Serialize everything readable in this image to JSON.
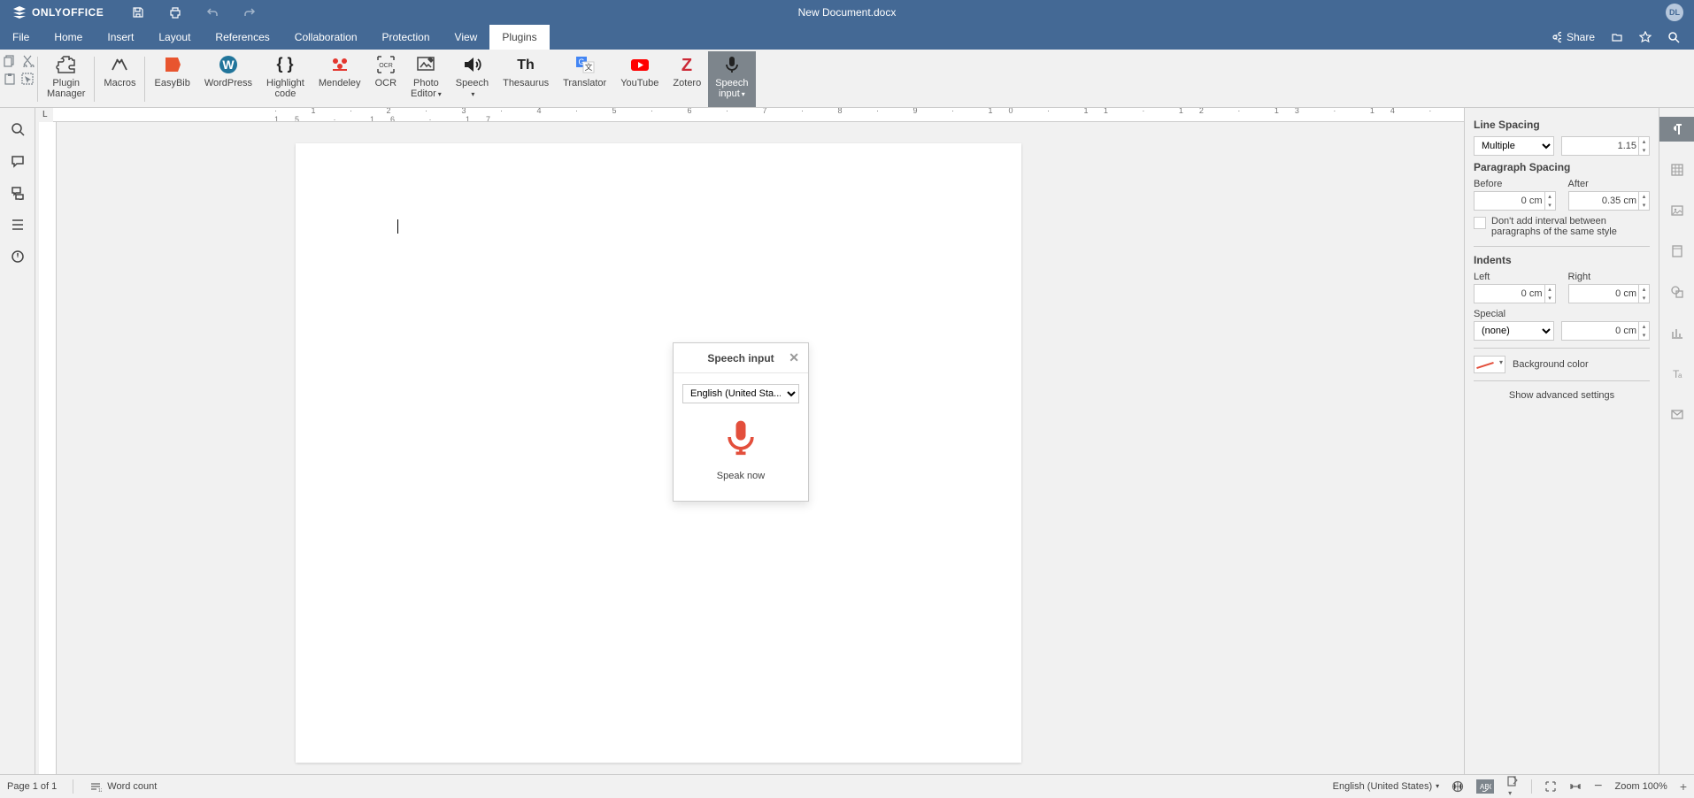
{
  "titlebar": {
    "brand": "ONLYOFFICE",
    "document": "New Document.docx",
    "avatar": "DL"
  },
  "menu": {
    "tabs": [
      "File",
      "Home",
      "Insert",
      "Layout",
      "References",
      "Collaboration",
      "Protection",
      "View",
      "Plugins"
    ],
    "active": "Plugins",
    "share": "Share"
  },
  "ribbon": {
    "plugin_manager": "Plugin\nManager",
    "macros": "Macros",
    "easybib": "EasyBib",
    "wordpress": "WordPress",
    "highlight": "Highlight\ncode",
    "mendeley": "Mendeley",
    "ocr": "OCR",
    "photo": "Photo\nEditor",
    "speech": "Speech",
    "thesaurus": "Thesaurus",
    "translator": "Translator",
    "youtube": "YouTube",
    "zotero": "Zotero",
    "speech_input": "Speech\ninput"
  },
  "speech_panel": {
    "title": "Speech input",
    "language": "English (United Sta...",
    "prompt": "Speak now"
  },
  "paragraph": {
    "line_spacing_label": "Line Spacing",
    "line_spacing_type": "Multiple",
    "line_spacing_value": "1.15",
    "paragraph_spacing_label": "Paragraph Spacing",
    "before_label": "Before",
    "before_value": "0 cm",
    "after_label": "After",
    "after_value": "0.35 cm",
    "no_interval_label": "Don't add interval between paragraphs of the same style",
    "indents_label": "Indents",
    "left_label": "Left",
    "left_value": "0 cm",
    "right_label": "Right",
    "right_value": "0 cm",
    "special_label": "Special",
    "special_type": "(none)",
    "special_value": "0 cm",
    "bg_label": "Background color",
    "advanced": "Show advanced settings"
  },
  "statusbar": {
    "page": "Page 1 of 1",
    "wordcount": "Word count",
    "language": "English (United States)",
    "zoom": "Zoom 100%"
  }
}
